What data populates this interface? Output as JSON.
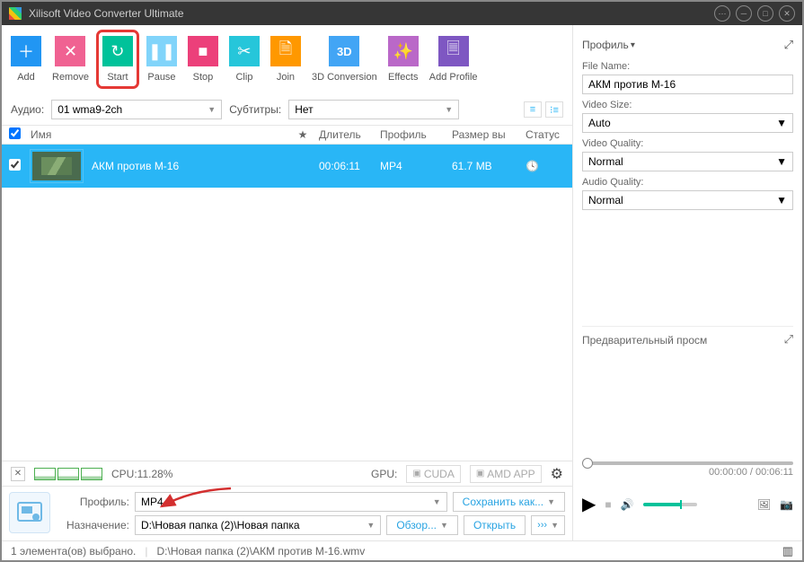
{
  "window": {
    "title": "Xilisoft Video Converter Ultimate"
  },
  "toolbar": {
    "add": "Add",
    "remove": "Remove",
    "start": "Start",
    "pause": "Pause",
    "stop": "Stop",
    "clip": "Clip",
    "join": "Join",
    "conv3d": "3D Conversion",
    "effects": "Effects",
    "addprofile": "Add Profile"
  },
  "filters": {
    "audio_label": "Аудио:",
    "audio_value": "01 wma9-2ch",
    "sub_label": "Субтитры:",
    "sub_value": "Нет"
  },
  "headers": {
    "name": "Имя",
    "star": "★",
    "duration": "Длитель",
    "profile": "Профиль",
    "size": "Размер вы",
    "status": "Статус"
  },
  "row": {
    "name": "АКМ против М-16",
    "duration": "00:06:11",
    "profile": "MP4",
    "size": "61.7 MB"
  },
  "sys": {
    "cpu_label": "CPU:",
    "cpu_val": "11.28%",
    "gpu_label": "GPU:",
    "cuda": "CUDA",
    "amd": "AMD APP"
  },
  "profile": {
    "label": "Профиль:",
    "value": "MP4",
    "save": "Сохранить как...",
    "dest_label": "Назначение:",
    "dest_value": "D:\\Новая папка (2)\\Новая папка",
    "browse": "Обзор...",
    "open": "Открыть"
  },
  "status": {
    "selected": "1 элемента(ов) выбрано.",
    "path": "D:\\Новая папка (2)\\АКМ против М-16.wmv"
  },
  "panel": {
    "profile_head": "Профиль",
    "filename_lbl": "File Name:",
    "filename_val": "АКМ против М-16",
    "vsize_lbl": "Video Size:",
    "vsize_val": "Auto",
    "vq_lbl": "Video Quality:",
    "vq_val": "Normal",
    "aq_lbl": "Audio Quality:",
    "aq_val": "Normal"
  },
  "preview": {
    "head": "Предварительный просм",
    "time": "00:00:00 / 00:06:11"
  }
}
